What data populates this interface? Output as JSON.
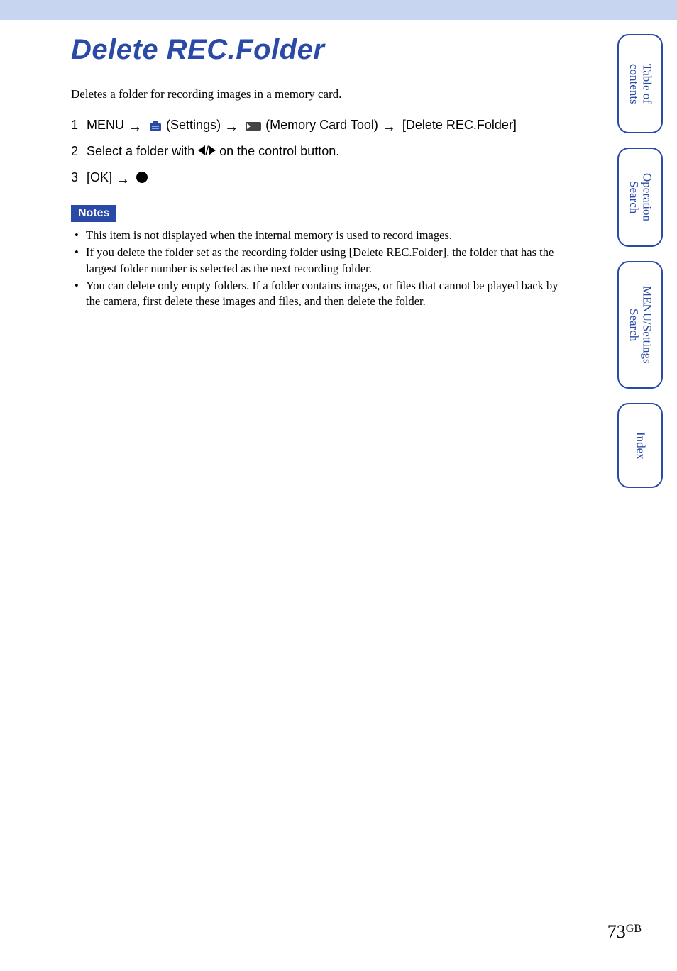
{
  "title": "Delete REC.Folder",
  "intro": "Deletes a folder for recording images in a memory card.",
  "steps": {
    "s1": {
      "num": "1",
      "menu": "MENU",
      "settings": "(Settings)",
      "memtool": "(Memory Card Tool)",
      "target": "[Delete REC.Folder]"
    },
    "s2": {
      "num": "2",
      "prefix": "Select a folder with ",
      "suffix": " on the control button."
    },
    "s3": {
      "num": "3",
      "ok": "[OK]"
    }
  },
  "notes": {
    "header": "Notes",
    "items": [
      "This item is not displayed when the internal memory is used to record images.",
      "If you delete the folder set as the recording folder using [Delete REC.Folder], the folder that has the largest folder number is selected as the next recording folder.",
      "You can delete only empty folders. If a folder contains images, or files that cannot be played back by the camera, first delete these images and files, and then delete the folder."
    ]
  },
  "tabs": {
    "t1a": "Table of",
    "t1b": "contents",
    "t2a": "Operation",
    "t2b": "Search",
    "t3a": "MENU/Settings",
    "t3b": "Search",
    "t4": "Index"
  },
  "page": {
    "num": "73",
    "suffix": "GB"
  }
}
